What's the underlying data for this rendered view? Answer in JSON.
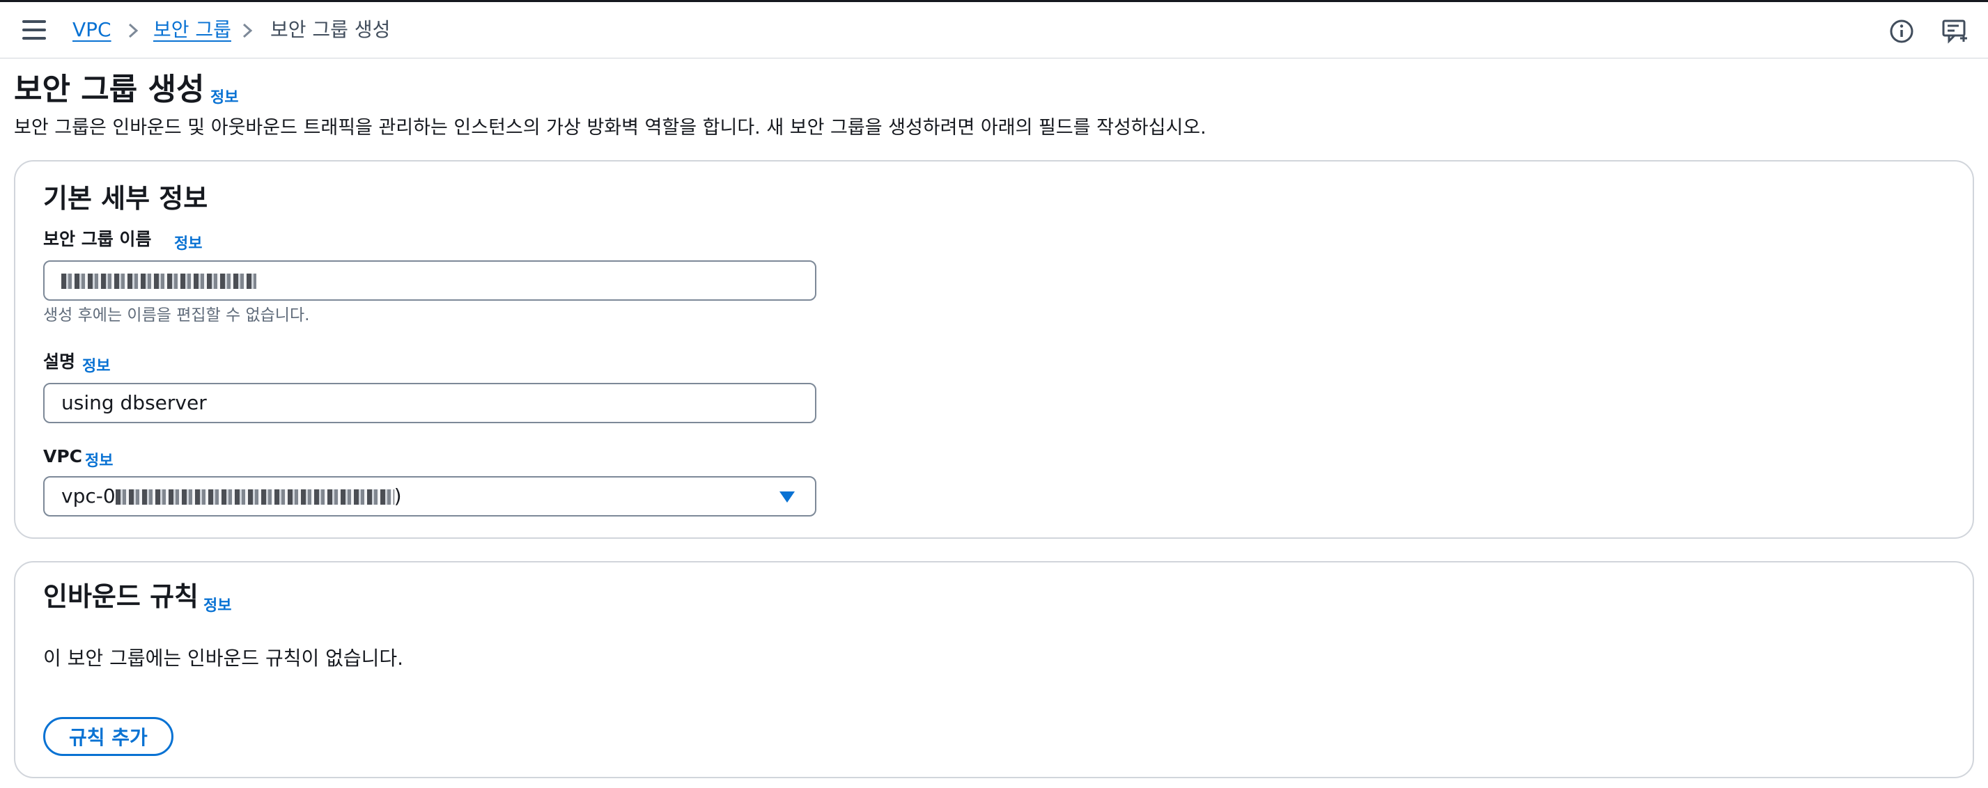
{
  "topbar": {
    "breadcrumbs": [
      {
        "label": "VPC"
      },
      {
        "label": "보안 그룹"
      },
      {
        "label": "보안 그룹 생성"
      }
    ],
    "icons": [
      "menu-icon",
      "info-circle-icon",
      "feedback-icon"
    ]
  },
  "header": {
    "title": "보안 그룹 생성",
    "info": "정보",
    "description": "보안 그룹은 인바운드 및 아웃바운드 트래픽을 관리하는 인스턴스의 가상 방화벽 역할을 합니다. 새 보안 그룹을 생성하려면 아래의 필드를 작성하십시오."
  },
  "basic": {
    "title": "기본 세부 정보",
    "name": {
      "label": "보안 그룹 이름",
      "info": "정보",
      "hint": "생성 후에는 이름을 편집할 수 없습니다."
    },
    "description": {
      "label": "설명",
      "info": "정보",
      "value": "using dbserver"
    },
    "vpc": {
      "label": "VPC",
      "info": "정보",
      "prefix": "vpc-0",
      "suffix": ")"
    }
  },
  "inbound": {
    "title": "인바운드 규칙",
    "info": "정보",
    "empty_text": "이 보안 그룹에는 인바운드 규칙이 없습니다.",
    "add_rule_label": "규칙 추가"
  },
  "colors": {
    "link": "#0972d3",
    "text": "#16191f",
    "border": "#7d8998"
  }
}
